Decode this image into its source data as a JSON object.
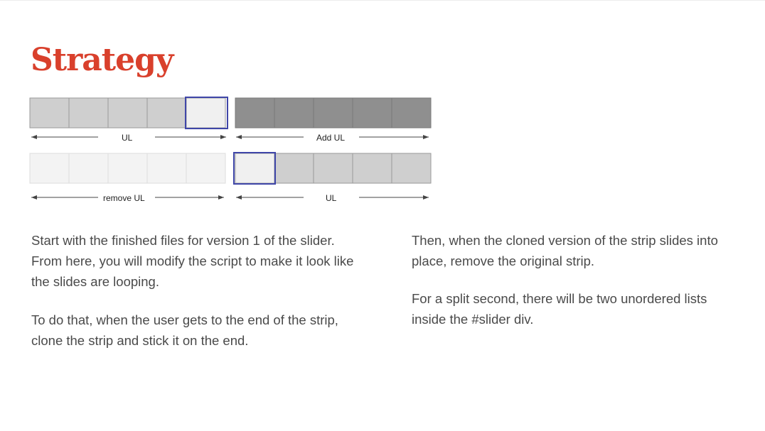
{
  "slide": {
    "title": "Strategy",
    "title_color": "#d9402c",
    "text_color": "#4a4a4a",
    "diagram": {
      "row1": {
        "left_label": "UL",
        "right_label": "Add UL"
      },
      "row2": {
        "left_label": "remove UL",
        "right_label": "UL"
      },
      "colors": {
        "cell_light": "#cfcfcf",
        "cell_dark": "#8f8f8f",
        "cell_faded": "#f3f3f3",
        "cell_highlight_fill": "#f0f0f0",
        "highlight_border": "#3f46a8"
      }
    },
    "left_column": {
      "paragraph_1": "Start with the finished files for version 1 of the slider. From here, you will modify the script to make it look like the slides are looping.",
      "paragraph_2": "To do that, when the user gets to the end of the strip, clone the strip and stick it on the end."
    },
    "right_column": {
      "paragraph_1": "Then, when the cloned version of the strip slides into place, remove the original strip.",
      "paragraph_2": "For a split second, there will be two unordered lists inside the #slider div."
    }
  }
}
